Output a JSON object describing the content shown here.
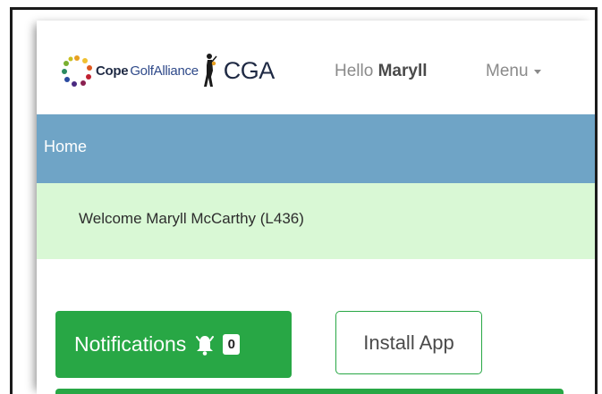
{
  "header": {
    "logo_cope": "Cope",
    "logo_golf_alliance": "GolfAlliance",
    "logo_abbrev": "CGA",
    "greeting_prefix": "Hello",
    "greeting_user": "Maryll",
    "menu_label": "Menu"
  },
  "breadcrumb": {
    "home_label": "Home"
  },
  "welcome": {
    "message": "Welcome Maryll McCarthy (L436)"
  },
  "actions": {
    "notifications_label": "Notifications",
    "notifications_count": "0",
    "install_label": "Install App"
  },
  "icons": {
    "logo": "cope-logo-icon",
    "golfer": "golfer-icon",
    "bell": "bell-icon",
    "menu_caret": "chevron-down-icon"
  },
  "colors": {
    "breadcrumb_bg": "#6fa4c6",
    "welcome_bg": "#d9f8d5",
    "primary_green": "#28a745"
  }
}
